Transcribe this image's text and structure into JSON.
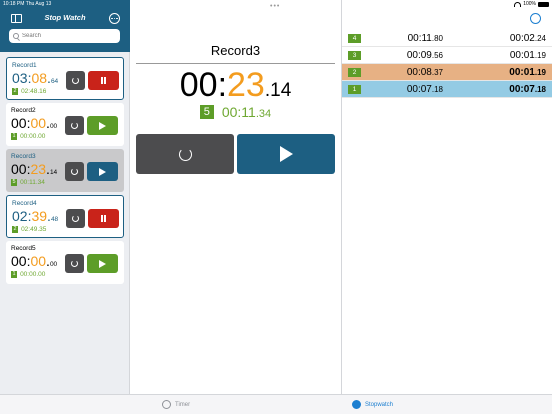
{
  "status": {
    "time": "10:18 PM  Thu Aug 13",
    "battery": "100%"
  },
  "app": {
    "title": "Stop Watch"
  },
  "search": {
    "placeholder": "Search"
  },
  "records": [
    {
      "name": "Record1",
      "state": "running",
      "min": "03",
      "sec": "08",
      "hs": "64",
      "lap_no": "2",
      "lap_time": "02:48.16"
    },
    {
      "name": "Record2",
      "state": "stopped",
      "min": "00",
      "sec": "00",
      "hs": "00",
      "lap_no": "1",
      "lap_time": "00:00.00"
    },
    {
      "name": "Record3",
      "state": "selected",
      "min": "00",
      "sec": "23",
      "hs": "14",
      "lap_no": "5",
      "lap_time": "00:11.34"
    },
    {
      "name": "Record4",
      "state": "running",
      "min": "02",
      "sec": "39",
      "hs": "48",
      "lap_no": "2",
      "lap_time": "02:49.35"
    },
    {
      "name": "Record5",
      "state": "stopped",
      "min": "00",
      "sec": "00",
      "hs": "00",
      "lap_no": "1",
      "lap_time": "00:00.00"
    }
  ],
  "detail": {
    "title": "Record3",
    "min": "00",
    "sec": "23",
    "hs": ".14",
    "lap_no": "5",
    "lap_main": "00:11",
    "lap_hs": ".34"
  },
  "laps": [
    {
      "no": "4",
      "split": "00:11",
      "split_hs": ".80",
      "total": "00:02",
      "total_hs": ".24"
    },
    {
      "no": "3",
      "split": "00:09",
      "split_hs": ".56",
      "total": "00:01",
      "total_hs": ".19"
    },
    {
      "no": "2",
      "split": "00:08",
      "split_hs": ".37",
      "total": "00:01",
      "total_hs": ".19"
    },
    {
      "no": "1",
      "split": "00:07",
      "split_hs": ".18",
      "total": "00:07",
      "total_hs": ".18"
    }
  ],
  "tabs": {
    "timer": "Timer",
    "stopwatch": "Stopwatch"
  },
  "colors": {
    "accent": "#1d5f82",
    "orange": "#f39c1f",
    "green": "#5d9d28",
    "red": "#c9231a",
    "lap_orange": "#e7b184",
    "lap_blue": "#94cbe4"
  }
}
